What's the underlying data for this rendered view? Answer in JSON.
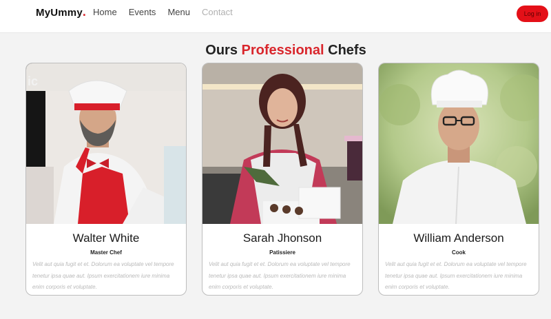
{
  "navbar": {
    "brand": "MyUmmy",
    "brand_dot": ".",
    "links": [
      "Home",
      "Events",
      "Menu",
      "Contact"
    ],
    "login_label": "Log in"
  },
  "section": {
    "title_prefix": "Ours",
    "title_accent": "Professional",
    "title_suffix": "Chefs"
  },
  "chefs": [
    {
      "name": "Walter White",
      "role": "Master Chef",
      "description": "Velit aut quia fugit et et. Dolorum ea voluptate vel tempore tenetur ipsa quae aut. Ipsum exercitationem iure minima enim corporis et voluptate."
    },
    {
      "name": "Sarah Jhonson",
      "role": "Patissiere",
      "description": "Velit aut quia fugit et et. Dolorum ea voluptate vel tempore tenetur ipsa quae aut. Ipsum exercitationem iure minima enim corporis et voluptate."
    },
    {
      "name": "William Anderson",
      "role": "Cook",
      "description": "Velit aut quia fugit et et. Dolorum ea voluptate vel tempore tenetur ipsa quae aut. Ipsum exercitationem iure minima enim corporis et voluptate."
    }
  ],
  "colors": {
    "accent": "#d9262c",
    "login_bg": "#e41018",
    "page_bg": "#f3f3f3"
  }
}
